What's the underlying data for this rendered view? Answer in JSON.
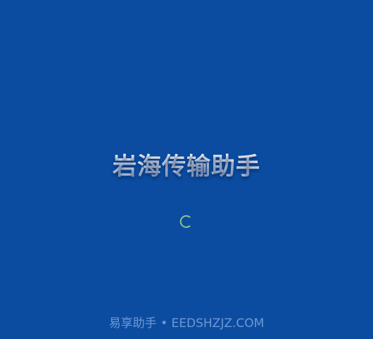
{
  "splash": {
    "title": "岩海传输助手",
    "footer": "易享助手 • EEDSHZJZ.COM"
  },
  "colors": {
    "background": "#0b4ca1",
    "title": "#ffffff",
    "spinner": "#8fc28a",
    "footer": "#6f98d2"
  },
  "icons": {
    "spinner": "loading-spinner-icon"
  }
}
